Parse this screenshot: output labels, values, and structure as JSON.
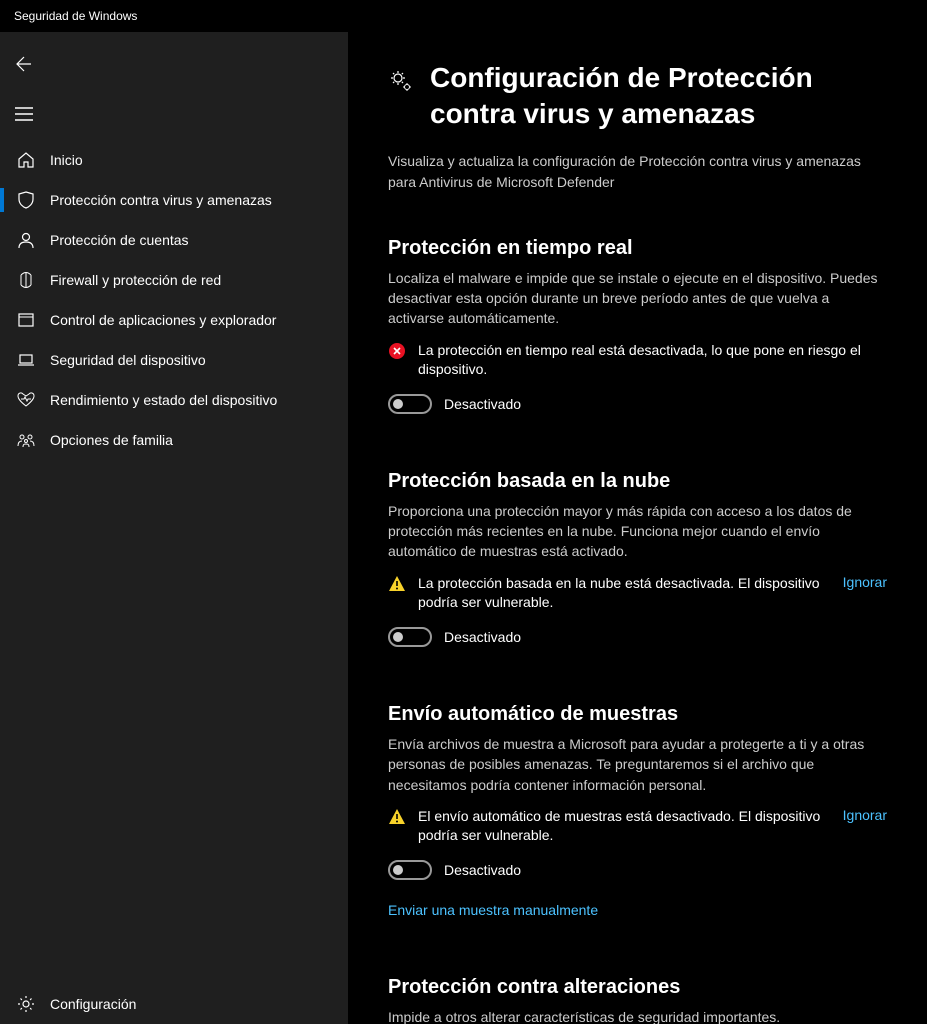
{
  "window_title": "Seguridad de Windows",
  "sidebar": {
    "items": [
      {
        "label": "Inicio"
      },
      {
        "label": "Protección contra virus y amenazas"
      },
      {
        "label": "Protección de cuentas"
      },
      {
        "label": "Firewall y protección de red"
      },
      {
        "label": "Control de aplicaciones y explorador"
      },
      {
        "label": "Seguridad del dispositivo"
      },
      {
        "label": "Rendimiento y estado del dispositivo"
      },
      {
        "label": "Opciones de familia"
      }
    ],
    "settings_label": "Configuración"
  },
  "page": {
    "title": "Configuración de Protección contra virus y amenazas",
    "description": "Visualiza y actualiza la configuración de Protección contra virus y amenazas para Antivirus de Microsoft Defender"
  },
  "sections": {
    "realtime": {
      "title": "Protección en tiempo real",
      "description": "Localiza el malware e impide que se instale o ejecute en el dispositivo. Puedes desactivar esta opción durante un breve período antes de que vuelva a activarse automáticamente.",
      "status": "La protección en tiempo real está desactivada, lo que pone en riesgo el dispositivo.",
      "toggle_label": "Desactivado"
    },
    "cloud": {
      "title": "Protección basada en la nube",
      "description": "Proporciona una protección mayor y más rápida con acceso a los datos de protección más recientes en la nube. Funciona mejor cuando el envío automático de muestras está activado.",
      "status": "La protección basada en la nube está desactivada. El dispositivo podría ser vulnerable.",
      "action": "Ignorar",
      "toggle_label": "Desactivado"
    },
    "samples": {
      "title": "Envío automático de muestras",
      "description": "Envía archivos de muestra a Microsoft para ayudar a protegerte a ti y a otras personas de posibles amenazas. Te preguntaremos si el archivo que necesitamos podría contener información personal.",
      "status": "El envío automático de muestras está desactivado. El dispositivo podría ser vulnerable.",
      "action": "Ignorar",
      "toggle_label": "Desactivado",
      "link": "Enviar una muestra manualmente"
    },
    "tamper": {
      "title": "Protección contra alteraciones",
      "description": "Impide a otros alterar características de seguridad importantes."
    }
  }
}
